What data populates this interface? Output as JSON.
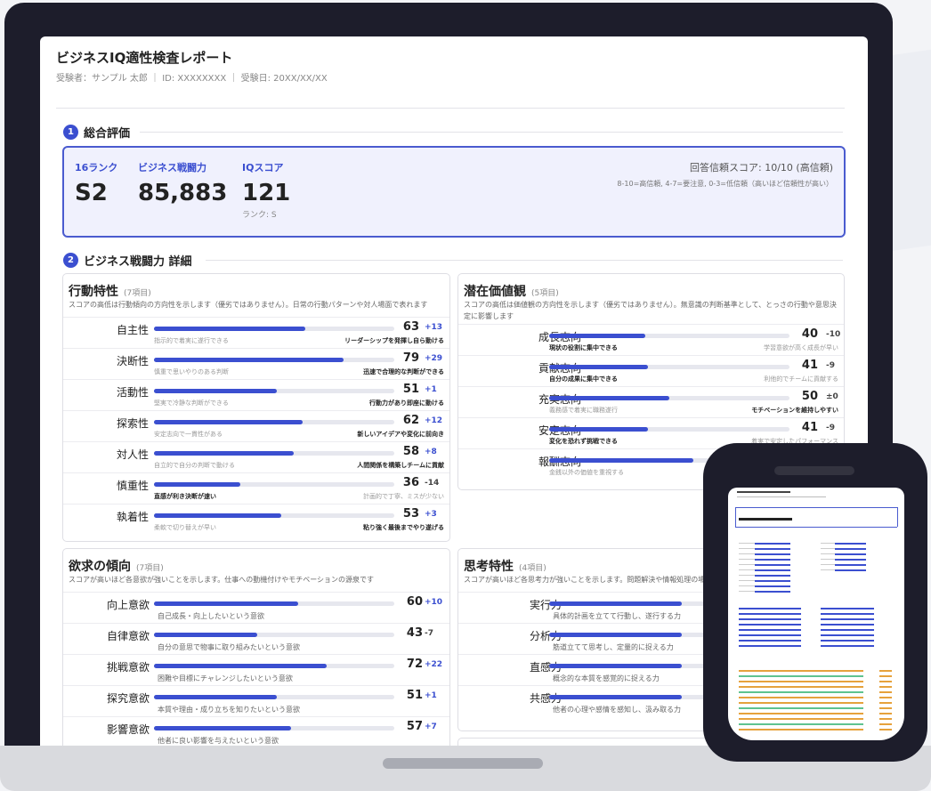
{
  "report": {
    "title": "ビジネスIQ適性検査レポート",
    "subtitle": "受験者：サンプル 太郎 ｜ ID: XXXXXXXX ｜ 受験日: 20XX/XX/XX"
  },
  "sections": {
    "s1": {
      "num": "1",
      "title": "総合評価"
    },
    "s2": {
      "num": "2",
      "title": "ビジネス戦闘力 詳細"
    }
  },
  "summary": {
    "rank16_label": "16ランク",
    "rank16_value": "S2",
    "power_label": "ビジネス戦闘力",
    "power_value": "85,883",
    "iq_label": "IQスコア",
    "iq_value": "121",
    "iq_rank": "ランク: S",
    "reliability": "回答信頼スコア: 10/10 (高信頼)",
    "reliability_note": "8-10=高信頼, 4-7=要注意, 0-3=低信頼（高いほど信頼性が高い）"
  },
  "accent": "#3b4fd0",
  "behavior": {
    "title": "行動特性",
    "count": "(7項目)",
    "desc": "スコアの高低は行動傾向の方向性を示します（優劣ではありません）。日常の行動パターンや対人場面で表れます",
    "items": [
      {
        "name": "自主性",
        "score": "63",
        "diff": "+13",
        "left": "指示的で着実に遂行できる",
        "right": "リーダーシップを発揮し自ら動ける",
        "strong": "right"
      },
      {
        "name": "決断性",
        "score": "79",
        "diff": "+29",
        "left": "慎重で思いやりのある判断",
        "right": "迅速で合理的な判断ができる",
        "strong": "right"
      },
      {
        "name": "活動性",
        "score": "51",
        "diff": "+1",
        "left": "堅実で冷静な判断ができる",
        "right": "行動力があり即座に動ける",
        "strong": "right"
      },
      {
        "name": "探索性",
        "score": "62",
        "diff": "+12",
        "left": "安定志向で一貫性がある",
        "right": "新しいアイデアや変化に前向き",
        "strong": "right"
      },
      {
        "name": "対人性",
        "score": "58",
        "diff": "+8",
        "left": "自立的で自分の判断で動ける",
        "right": "人間関係を構築しチームに貢献",
        "strong": "right"
      },
      {
        "name": "慎重性",
        "score": "36",
        "diff": "-14",
        "left": "直感が利き決断が速い",
        "right": "計画的で丁寧、ミスが少ない",
        "strong": "left"
      },
      {
        "name": "執着性",
        "score": "53",
        "diff": "+3",
        "left": "柔軟で切り替えが早い",
        "right": "粘り強く最後までやり遂げる",
        "strong": "right"
      }
    ]
  },
  "values": {
    "title": "潜在価値観",
    "count": "(5項目)",
    "desc": "スコアの高低は価値観の方向性を示します（優劣ではありません）。無意識の判断基準として、とっさの行動や意思決定に影響します",
    "items": [
      {
        "name": "成長志向",
        "score": "40",
        "diff": "-10",
        "left": "現状の役割に集中できる",
        "right": "学習意欲が高く成長が早い",
        "strong": "left"
      },
      {
        "name": "貢献志向",
        "score": "41",
        "diff": "-9",
        "left": "自分の成果に集中できる",
        "right": "利他的でチームに貢献する",
        "strong": "left"
      },
      {
        "name": "充実志向",
        "score": "50",
        "diff": "±0",
        "left": "義務感で着実に職務遂行",
        "right": "モチベーションを維持しやすい",
        "strong": "right"
      },
      {
        "name": "安定志向",
        "score": "41",
        "diff": "-9",
        "left": "変化を恐れず挑戦できる",
        "right": "着実で安定したパフォーマンス",
        "strong": "left"
      },
      {
        "name": "報酬志向",
        "score": "",
        "diff": "",
        "left": "金銭以外の価値を重視する",
        "right": "",
        "strong": ""
      }
    ]
  },
  "desire": {
    "title": "欲求の傾向",
    "count": "(7項目)",
    "desc": "スコアが高いほど各意欲が強いことを示します。仕事への動機付けやモチベーションの源泉です",
    "items": [
      {
        "name": "向上意欲",
        "score": "60",
        "diff": "+10",
        "caption": "自己成長・向上したいという意欲"
      },
      {
        "name": "自律意欲",
        "score": "43",
        "diff": "-7",
        "caption": "自分の意思で物事に取り組みたいという意欲"
      },
      {
        "name": "挑戦意欲",
        "score": "72",
        "diff": "+22",
        "caption": "困難や目標にチャレンジしたいという意欲"
      },
      {
        "name": "探究意欲",
        "score": "51",
        "diff": "+1",
        "caption": "本質や理由・成り立ちを知りたいという意欲"
      },
      {
        "name": "影響意欲",
        "score": "57",
        "diff": "+7",
        "caption": "他者に良い影響を与えたいという意欲"
      }
    ]
  },
  "thinking": {
    "title": "思考特性",
    "count": "(4項目)",
    "desc": "スコアが高いほど各思考力が強いことを示します。問題解決や情報処理の場面で",
    "items": [
      {
        "name": "実行力",
        "caption": "具体的計画を立てて行動し、遂行する力"
      },
      {
        "name": "分析力",
        "caption": "筋道立てて思考し、定量的に捉える力"
      },
      {
        "name": "直感力",
        "caption": "概念的な本質を感覚的に捉える力"
      },
      {
        "name": "共感力",
        "caption": "他者の心理や感情を感知し、汲み取る力"
      }
    ]
  }
}
